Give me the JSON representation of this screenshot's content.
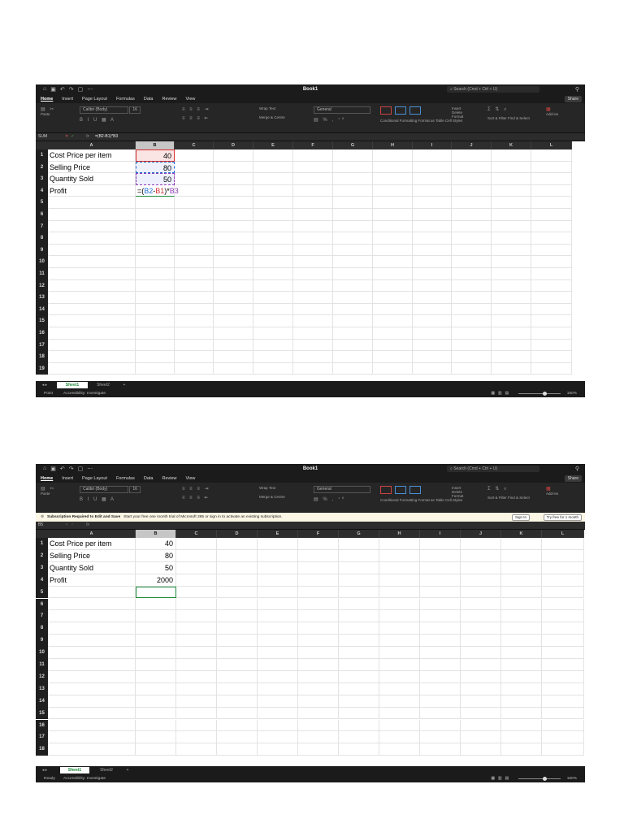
{
  "common": {
    "menu": [
      "Home",
      "Insert",
      "Page Layout",
      "Formulas",
      "Data",
      "Review",
      "View"
    ],
    "doc_title": "Book1",
    "search_placeholder": "Search (Cmd + Ctrl + U)",
    "share_label": "Share",
    "font_name": "Calibri (Body)",
    "font_size": "16",
    "number_format": "General",
    "wrap_text": "Wrap Text",
    "merge_centre": "Merge & Centre",
    "conditional_formatting": "Conditional Formatting",
    "format_as_table": "Format as Table",
    "cell_styles": "Cell Styles",
    "insert": "Insert",
    "delete": "Delete",
    "format": "Format",
    "sort_filter": "Sort & Filter",
    "find_select": "Find & Select",
    "add_ins": "Add-ins",
    "paste": "Paste",
    "columns": [
      "A",
      "B",
      "C",
      "D",
      "E",
      "F",
      "G",
      "H",
      "I",
      "J",
      "K",
      "L"
    ],
    "sheet_tabs": [
      "Sheet1",
      "Sheet2"
    ],
    "add_sheet": "+",
    "accessibility": "Accessibility: Investigate",
    "zoom": "160%",
    "fx": "fx"
  },
  "screen1": {
    "name_box": "SUM",
    "formula": "=(B2-B1)*B3",
    "mode": "Point",
    "selected_col": "B",
    "rows": [
      {
        "n": "1",
        "a": "Cost Price per item",
        "b": "40"
      },
      {
        "n": "2",
        "a": "Selling Price",
        "b": "80"
      },
      {
        "n": "3",
        "a": "Quantity Sold",
        "b": "50"
      },
      {
        "n": "4",
        "a": "Profit",
        "b": ""
      },
      {
        "n": "5"
      },
      {
        "n": "6"
      },
      {
        "n": "7"
      },
      {
        "n": "8"
      },
      {
        "n": "9"
      },
      {
        "n": "10"
      },
      {
        "n": "11"
      },
      {
        "n": "12"
      },
      {
        "n": "13"
      },
      {
        "n": "14"
      },
      {
        "n": "15"
      },
      {
        "n": "16"
      },
      {
        "n": "17"
      },
      {
        "n": "18"
      },
      {
        "n": "19"
      }
    ],
    "edit_formula": [
      {
        "t": "=(",
        "c": "#000000"
      },
      {
        "t": "B2",
        "c": "#1f6fd1"
      },
      {
        "t": "-",
        "c": "#000000"
      },
      {
        "t": "B1",
        "c": "#d32f2f"
      },
      {
        "t": ")*",
        "c": "#000000"
      },
      {
        "t": "B3",
        "c": "#8e3bb5"
      }
    ]
  },
  "screen2": {
    "name_box": "B5",
    "formula": "",
    "mode": "Ready",
    "selected_col": "B",
    "banner_title": "Subscription Required to Edit and Save",
    "banner_text": "Start your free one month trial of Microsoft 365 or sign in to activate an existing subscription.",
    "sign_in": "Sign In",
    "try_free": "Try free for 1 month",
    "rows": [
      {
        "n": "1",
        "a": "Cost Price per item",
        "b": "40"
      },
      {
        "n": "2",
        "a": "Selling Price",
        "b": "80"
      },
      {
        "n": "3",
        "a": "Quantity Sold",
        "b": "50"
      },
      {
        "n": "4",
        "a": "Profit",
        "b": "2000"
      },
      {
        "n": "5"
      },
      {
        "n": "6"
      },
      {
        "n": "7"
      },
      {
        "n": "8"
      },
      {
        "n": "9"
      },
      {
        "n": "10"
      },
      {
        "n": "11"
      },
      {
        "n": "12"
      },
      {
        "n": "13"
      },
      {
        "n": "14"
      },
      {
        "n": "15"
      },
      {
        "n": "16"
      },
      {
        "n": "17"
      },
      {
        "n": "18"
      }
    ]
  }
}
